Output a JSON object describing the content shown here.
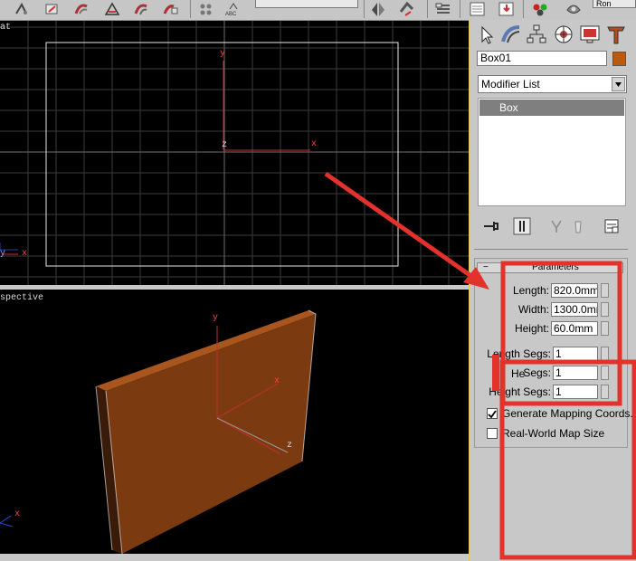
{
  "toolbar": {
    "icons": [
      "select-icon",
      "link-icon",
      "bind-icon",
      "move-icon",
      "rotate-icon",
      "scale-icon",
      "align-icon",
      "spinner-snap-icon",
      "spelling-icon",
      "mirror-icon",
      "align-tool-icon",
      "layers-icon",
      "curve-editor-icon",
      "render-setup-icon",
      "material-editor-icon",
      "render-icon"
    ],
    "truncated_label": "Ron"
  },
  "viewports": {
    "top": {
      "label": "at",
      "axis_x": "x",
      "axis_y": "y",
      "axis_z": "z"
    },
    "perspective": {
      "label": "spective",
      "axis_x": "x",
      "axis_y": "y",
      "axis_z": "z"
    }
  },
  "panel": {
    "tabs": [
      "create-tab",
      "modify-tab",
      "hierarchy-tab",
      "motion-tab",
      "display-tab",
      "utilities-tab"
    ],
    "object_name": "Box01",
    "object_color": "#b85a12",
    "modifier_list": "Modifier List",
    "stack_items": [
      "Box"
    ],
    "rollout_title": "Parameters",
    "params": {
      "length": {
        "label": "Length:",
        "value": "820.0mm"
      },
      "width": {
        "label": "Width:",
        "value": "1300.0mm"
      },
      "height": {
        "label": "Height:",
        "value": "60.0mm"
      },
      "length_segs": {
        "label": "Length Segs:",
        "value": "1"
      },
      "width_segs": {
        "label": "Segs:",
        "value": "1"
      },
      "height_segs": {
        "label": "Height Segs:",
        "value": "1"
      },
      "width_segs_prefix": "He"
    },
    "checkboxes": {
      "generate_mapping": {
        "label": "Generate Mapping Coords.",
        "checked": true
      },
      "real_world": {
        "label": "Real-World Map Size",
        "checked": false
      }
    }
  },
  "annotation": {
    "color": "#e3322b"
  }
}
